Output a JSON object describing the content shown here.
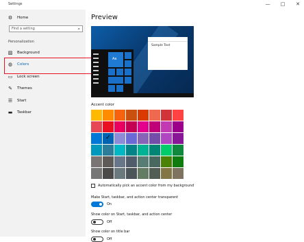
{
  "window": {
    "title": "Settings",
    "minimize": "—",
    "maximize": "□",
    "close": "✕"
  },
  "sidebar": {
    "home": {
      "label": "Home",
      "icon": "gear-icon"
    },
    "search": {
      "placeholder": "Find a setting"
    },
    "section": "Personalization",
    "items": [
      {
        "label": "Background",
        "icon": "image-icon"
      },
      {
        "label": "Colors",
        "icon": "palette-icon"
      },
      {
        "label": "Lock screen",
        "icon": "lock-screen-icon"
      },
      {
        "label": "Themes",
        "icon": "brush-icon"
      },
      {
        "label": "Start",
        "icon": "start-icon"
      },
      {
        "label": "Taskbar",
        "icon": "taskbar-icon"
      }
    ],
    "selected": "Colors"
  },
  "main": {
    "heading": "Preview",
    "preview": {
      "window_text": "Sample Text",
      "tile_text": "Aa"
    },
    "accent_label": "Accent color",
    "auto_pick": {
      "label": "Automatically pick an accent color from my background",
      "checked": false
    },
    "options": [
      {
        "label": "Make Start, taskbar, and action center transparent",
        "state": "On",
        "on": true
      },
      {
        "label": "Show color on Start, taskbar, and action center",
        "state": "Off",
        "on": false
      },
      {
        "label": "Show color on title bar",
        "state": "Off",
        "on": false
      }
    ]
  },
  "accent_colors": [
    "#ffb900",
    "#ff8c00",
    "#f7630c",
    "#ca5010",
    "#da3b01",
    "#ef6950",
    "#d13438",
    "#ff4343",
    "#e74856",
    "#e81123",
    "#ea005e",
    "#c30052",
    "#e3008c",
    "#bf0077",
    "#c239b3",
    "#9a0089",
    "#0078d7",
    "#0063b1",
    "#8e8cd8",
    "#6b69d6",
    "#8764b8",
    "#744da9",
    "#b146c2",
    "#881798",
    "#0099bc",
    "#2d7d9a",
    "#00b7c3",
    "#038387",
    "#00b294",
    "#018574",
    "#00cc6a",
    "#10893e",
    "#7a7574",
    "#5d5a58",
    "#68768a",
    "#515c6b",
    "#567c73",
    "#486860",
    "#498205",
    "#107c10",
    "#767676",
    "#4c4a48",
    "#69797e",
    "#4a5459",
    "#647c64",
    "#525e54",
    "#847545",
    "#7e735f"
  ],
  "selected_color_index": 17
}
